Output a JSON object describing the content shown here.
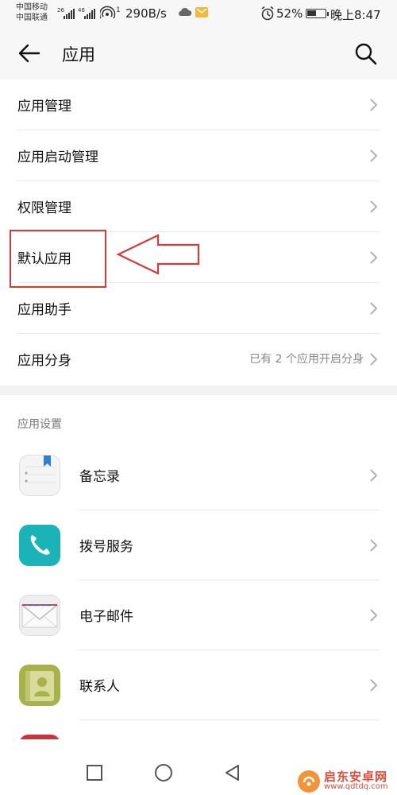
{
  "status_bar": {
    "carrier_1": "中国移动",
    "carrier_2": "中国联通",
    "net_1": "26",
    "net_2": "46",
    "hotspot_count": "1",
    "speed": "290B/s",
    "battery_pct": "52%",
    "battery_level": 0.52,
    "time": "晚上8:47"
  },
  "header": {
    "title": "应用",
    "back_icon": "arrow-left-icon",
    "search_icon": "search-icon"
  },
  "menu": [
    {
      "label": "应用管理"
    },
    {
      "label": "应用启动管理"
    },
    {
      "label": "权限管理"
    },
    {
      "label": "默认应用"
    },
    {
      "label": "应用助手"
    },
    {
      "label": "应用分身",
      "value": "已有 2 个应用开启分身"
    }
  ],
  "section_title": "应用设置",
  "app_settings": [
    {
      "label": "备忘录",
      "icon": "notepad-icon"
    },
    {
      "label": "拨号服务",
      "icon": "phone-icon"
    },
    {
      "label": "电子邮件",
      "icon": "email-icon"
    },
    {
      "label": "联系人",
      "icon": "contacts-icon"
    }
  ],
  "nav": {
    "recent_icon": "square-icon",
    "home_icon": "circle-icon",
    "back_icon": "triangle-back-icon"
  },
  "watermark": {
    "name": "启东安卓网",
    "url": "www.qdtdq.com"
  },
  "colors": {
    "annotation": "#d83a3a",
    "phone_icon": "#1ab3b8",
    "contacts_icon": "#a7b34a",
    "notes_bookmark": "#2f7fd8"
  }
}
